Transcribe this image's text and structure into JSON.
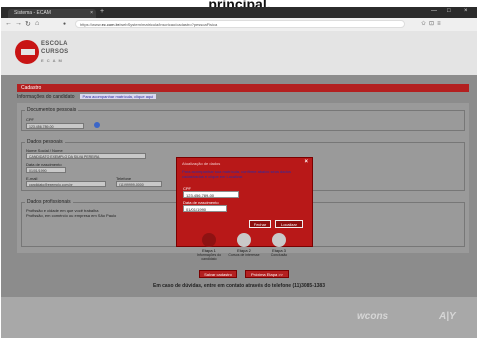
{
  "caption": "principal.",
  "browser": {
    "tab_title": "Sistema - ECAM",
    "tab_close": "×",
    "new_tab": "+",
    "url_prefix": "https://www.",
    "url_host": "ec.com.br",
    "url_rest": "/webSystem/matricula/inscricao/cadastro?pessoaFisica",
    "window_controls": [
      "—",
      "□",
      "×"
    ],
    "toolbar_icons": [
      "✩",
      "⊡",
      "≡"
    ]
  },
  "site": {
    "logo_line1": "ESCOLA",
    "logo_line2": "CURSOS",
    "logo_line3": "E C A M"
  },
  "page": {
    "section_title": "Cadastro",
    "info_label": "Informações do candidato",
    "info_chip": "Para acompanhar matrícula, clique aqui"
  },
  "form": {
    "documentos": {
      "legend": "Documentos pessoais",
      "cpf_label": "CPF",
      "cpf_value": "123.456.789-00"
    },
    "dados_pessoais": {
      "legend": "Dados pessoais",
      "nome_label": "Nome Social / Nome",
      "nome_value": "CANDIDATO EXEMPLO DA SILVA PEREIRA",
      "nascimento_label": "Data de nascimento",
      "nascimento_value": "01/01/1990",
      "email_label": "E-mail",
      "email_value": "candidato@exemplo.com.br",
      "telefone_label": "Telefone",
      "telefone_value": "(11)99999-0000"
    },
    "dados_profissionais": {
      "legend": "Dados profissionais",
      "line1": "Profissão e cidade em que você trabalha",
      "line2": "Profissão, em comércio ou empresa em São Paulo"
    }
  },
  "modal": {
    "title": "Atualização de dados",
    "text": "Para acompanhar sua matrícula, confirme abaixo seus dados cadastrados e clique em Localizar.",
    "cpf_label": "CPF",
    "cpf_value": "123.456.789-00",
    "nasc_label": "Data de nascimento",
    "nasc_value": "01/01/1990",
    "close_icon": "×",
    "fechar_label": "Fechar",
    "localizar_label": "Localizar"
  },
  "steps": [
    {
      "num": "Etapa 1",
      "desc": "Informações do candidato",
      "color": "#8e1212"
    },
    {
      "num": "Etapa 2",
      "desc": "Cursos de interesse",
      "color": "#c9c9c9"
    },
    {
      "num": "Etapa 3",
      "desc": "Conclusão",
      "color": "#c9c9c9"
    }
  ],
  "actions": {
    "salvar_label": "Salvar cadastro",
    "proxima_label": "Próxima Etapa >>"
  },
  "help_text": "Em caso de dúvidas, entre em contato através do telefone (11)3085-1383",
  "footer": {
    "brand1": "wcons",
    "brand2": "A|Y"
  },
  "colors": {
    "brand_red": "#b32020",
    "modal_red": "#b81818",
    "link_blue": "#2b2ba8"
  }
}
